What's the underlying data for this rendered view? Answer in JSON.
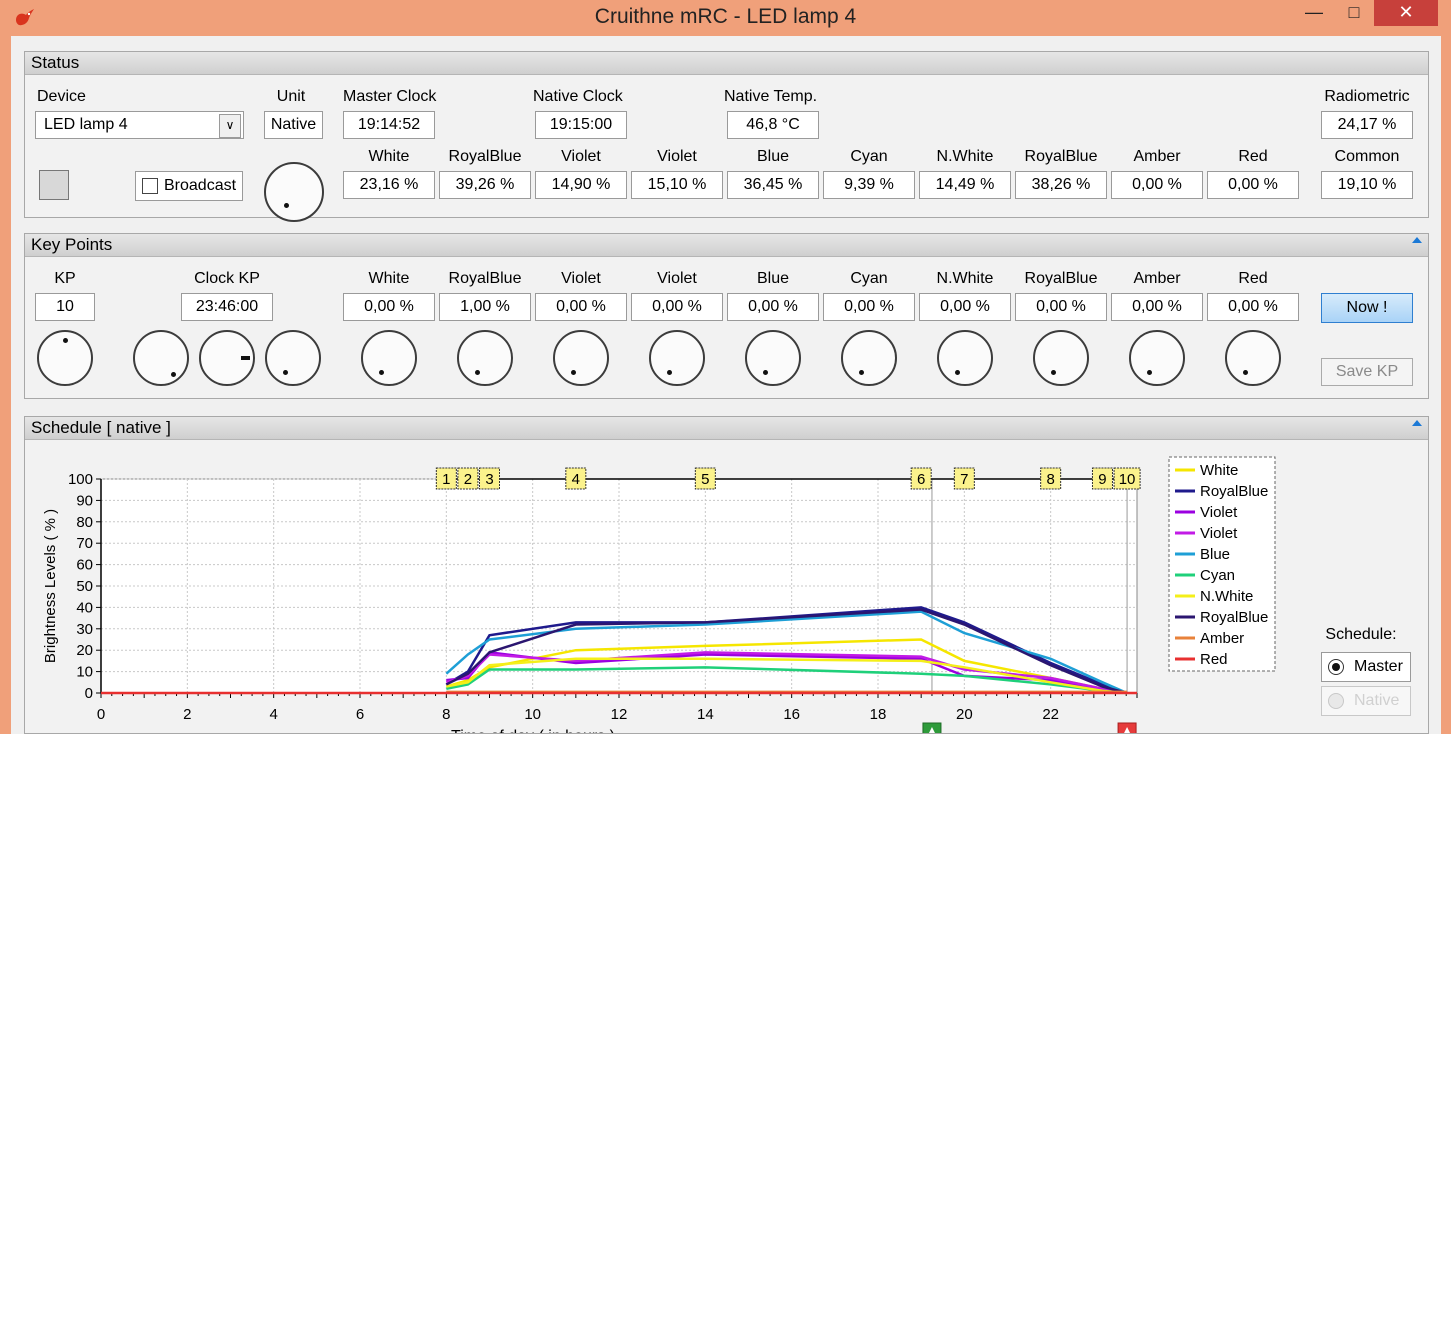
{
  "window": {
    "title": "Cruithne mRC   -   LED lamp 4",
    "minimize_icon": "minimize-icon",
    "maximize_icon": "maximize-icon",
    "close_icon": "close-icon",
    "min_glyph": "—",
    "max_glyph": "□",
    "close_glyph": "✕"
  },
  "status": {
    "title": "Status",
    "device_label": "Device",
    "device_value": "LED lamp 4",
    "unit_label": "Unit",
    "unit_value": "Native",
    "master_clock_label": "Master Clock",
    "master_clock_value": "19:14:52",
    "native_clock_label": "Native  Clock",
    "native_clock_value": "19:15:00",
    "native_temp_label": "Native  Temp.",
    "native_temp_value": "46,8 °C",
    "radiometric_label": "Radiometric",
    "radiometric_value": "24,17 %",
    "common_label": "Common",
    "common_value": "19,10 %",
    "broadcast_label": "Broadcast",
    "channels": [
      {
        "name": "White",
        "value": "23,16 %"
      },
      {
        "name": "RoyalBlue",
        "value": "39,26 %"
      },
      {
        "name": "Violet",
        "value": "14,90 %"
      },
      {
        "name": "Violet",
        "value": "15,10 %"
      },
      {
        "name": "Blue",
        "value": "36,45 %"
      },
      {
        "name": "Cyan",
        "value": "9,39 %"
      },
      {
        "name": "N.White",
        "value": "14,49 %"
      },
      {
        "name": "RoyalBlue",
        "value": "38,26 %"
      },
      {
        "name": "Amber",
        "value": "0,00 %"
      },
      {
        "name": "Red",
        "value": "0,00 %"
      }
    ]
  },
  "keypoints": {
    "title": "Key Points",
    "kp_label": "KP",
    "kp_value": "10",
    "clock_label": "Clock  KP",
    "clock_value": "23:46:00",
    "now_label": "Now !",
    "save_label": "Save  KP",
    "channels": [
      {
        "name": "White",
        "value": "0,00 %"
      },
      {
        "name": "RoyalBlue",
        "value": "1,00 %"
      },
      {
        "name": "Violet",
        "value": "0,00 %"
      },
      {
        "name": "Violet",
        "value": "0,00 %"
      },
      {
        "name": "Blue",
        "value": "0,00 %"
      },
      {
        "name": "Cyan",
        "value": "0,00 %"
      },
      {
        "name": "N.White",
        "value": "0,00 %"
      },
      {
        "name": "RoyalBlue",
        "value": "0,00 %"
      },
      {
        "name": "Amber",
        "value": "0,00 %"
      },
      {
        "name": "Red",
        "value": "0,00 %"
      }
    ]
  },
  "schedule": {
    "title": "Schedule  [ native ]",
    "mode_label": "Schedule:",
    "master_label": "Master",
    "native_label": "Native",
    "selected": "Master"
  },
  "chart_data": {
    "type": "line",
    "xlabel": "Time of day  ( in hours )",
    "ylabel": "Brightness Levels  ( % )",
    "xlim": [
      0,
      24
    ],
    "ylim": [
      0,
      100
    ],
    "xticks": [
      0,
      2,
      4,
      6,
      8,
      10,
      12,
      14,
      16,
      18,
      20,
      22
    ],
    "yticks": [
      0,
      10,
      20,
      30,
      40,
      50,
      60,
      70,
      80,
      90,
      100
    ],
    "grid": true,
    "legend_position": "right",
    "current_time": 19.25,
    "end_time": 23.77,
    "keypoints": [
      {
        "label": "1",
        "x": 8.0
      },
      {
        "label": "2",
        "x": 8.5
      },
      {
        "label": "3",
        "x": 9.0
      },
      {
        "label": "4",
        "x": 11.0
      },
      {
        "label": "5",
        "x": 14.0
      },
      {
        "label": "6",
        "x": 19.0
      },
      {
        "label": "7",
        "x": 20.0
      },
      {
        "label": "8",
        "x": 22.0
      },
      {
        "label": "9",
        "x": 23.2
      },
      {
        "label": "10",
        "x": 23.77
      }
    ],
    "series": [
      {
        "name": "White",
        "color": "#f5e600",
        "x": [
          8,
          8.5,
          9,
          11,
          14,
          19,
          20,
          22,
          23.2,
          23.77
        ],
        "y": [
          3,
          6,
          12,
          20,
          22,
          25,
          15,
          7,
          2,
          0
        ]
      },
      {
        "name": "RoyalBlue",
        "color": "#1f1a8c",
        "x": [
          8,
          8.5,
          9,
          11,
          14,
          19,
          20,
          22,
          23.2,
          23.77
        ],
        "y": [
          4,
          10,
          27,
          33,
          33,
          40,
          33,
          14,
          4,
          0
        ]
      },
      {
        "name": "Violet",
        "color": "#9b00e0",
        "x": [
          8,
          8.5,
          9,
          11,
          14,
          19,
          20,
          22,
          23.2,
          23.77
        ],
        "y": [
          6,
          7,
          19,
          14,
          18,
          16,
          8,
          6,
          2,
          0
        ]
      },
      {
        "name": "Violet",
        "color": "#c21be6",
        "x": [
          8,
          8.5,
          9,
          11,
          14,
          19,
          20,
          22,
          23.2,
          23.77
        ],
        "y": [
          5,
          8,
          18,
          15,
          19,
          17,
          11,
          7,
          2,
          0
        ]
      },
      {
        "name": "Blue",
        "color": "#1e9fd6",
        "x": [
          8,
          8.5,
          9,
          11,
          14,
          19,
          20,
          22,
          23.2,
          23.77
        ],
        "y": [
          9,
          18,
          25,
          30,
          32,
          38,
          28,
          16,
          5,
          0
        ]
      },
      {
        "name": "Cyan",
        "color": "#1fd07a",
        "x": [
          8,
          8.5,
          9,
          11,
          14,
          19,
          20,
          22,
          23.2,
          23.77
        ],
        "y": [
          2,
          4,
          11,
          11,
          12,
          9,
          8,
          4,
          1,
          0
        ]
      },
      {
        "name": "N.White",
        "color": "#f4ef1a",
        "x": [
          8,
          8.5,
          9,
          11,
          14,
          19,
          20,
          22,
          23.2,
          23.77
        ],
        "y": [
          3,
          5,
          13,
          16,
          16,
          15,
          12,
          5,
          1,
          0
        ]
      },
      {
        "name": "RoyalBlue",
        "color": "#2b1670",
        "x": [
          8,
          8.5,
          9,
          11,
          14,
          19,
          20,
          22,
          23.2,
          23.77
        ],
        "y": [
          4,
          9,
          19,
          32,
          33,
          39,
          32,
          13,
          3,
          0
        ]
      },
      {
        "name": "Amber",
        "color": "#e8823a",
        "x": [
          8,
          23.77
        ],
        "y": [
          0.5,
          0.5
        ]
      },
      {
        "name": "Red",
        "color": "#e83030",
        "x": [
          0,
          24
        ],
        "y": [
          0,
          0
        ]
      }
    ]
  }
}
